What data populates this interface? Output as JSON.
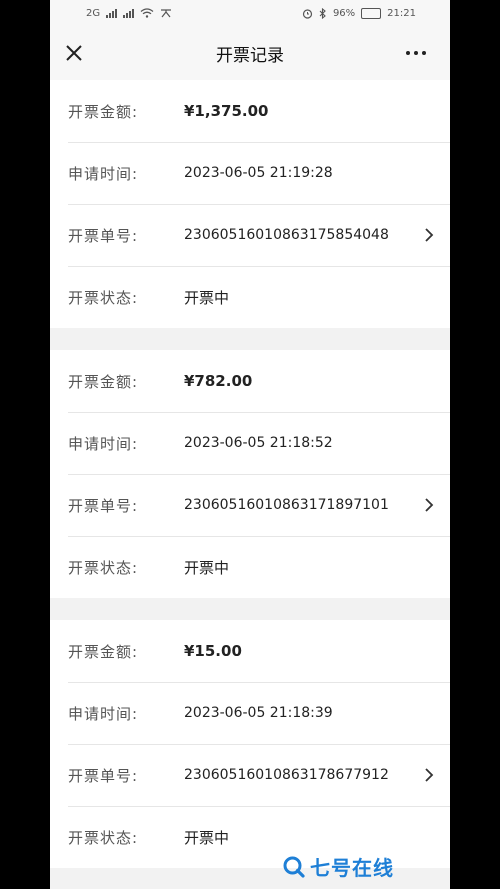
{
  "status_bar": {
    "network": "2G",
    "battery": "96%",
    "time": "21:21"
  },
  "navbar": {
    "title": "开票记录"
  },
  "labels": {
    "amount": "开票金额:",
    "apply_time": "申请时间:",
    "invoice_no": "开票单号:",
    "status": "开票状态:"
  },
  "records": [
    {
      "amount": "¥1,375.00",
      "apply_time": "2023-06-05 21:19:28",
      "invoice_no": "230605160108631758540​48",
      "status": "开票中"
    },
    {
      "amount": "¥782.00",
      "apply_time": "2023-06-05 21:18:52",
      "invoice_no": "2306051601086317189710​1",
      "status": "开票中"
    },
    {
      "amount": "¥15.00",
      "apply_time": "2023-06-05 21:18:39",
      "invoice_no": "23060516010863178677912",
      "status": "开票中"
    }
  ],
  "watermark": {
    "text": "七号在线"
  },
  "colors": {
    "background": "#f2f2f2",
    "card": "#ffffff",
    "watermark": "#1e7fd6"
  }
}
